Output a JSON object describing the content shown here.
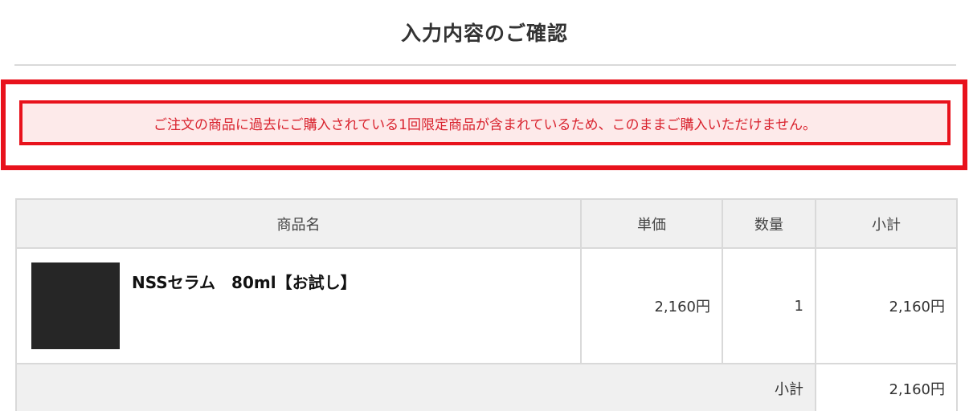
{
  "page": {
    "title": "入力内容のご確認"
  },
  "alert": {
    "message": "ご注文の商品に過去にご購入されている1回限定商品が含まれているため、このままご購入いただけません。",
    "color": "#d9232e",
    "border_color": "#e8121c",
    "background": "#fdeaea"
  },
  "table": {
    "headers": {
      "product": "商品名",
      "unit_price": "単価",
      "quantity": "数量",
      "subtotal": "小計"
    },
    "rows": [
      {
        "image": "product-thumbnail",
        "name": "NSSセラム　80ml【お試し】",
        "unit_price": "2,160円",
        "quantity": "1",
        "subtotal": "2,160円"
      }
    ],
    "footer": {
      "label": "小計",
      "value": "2,160円"
    }
  }
}
